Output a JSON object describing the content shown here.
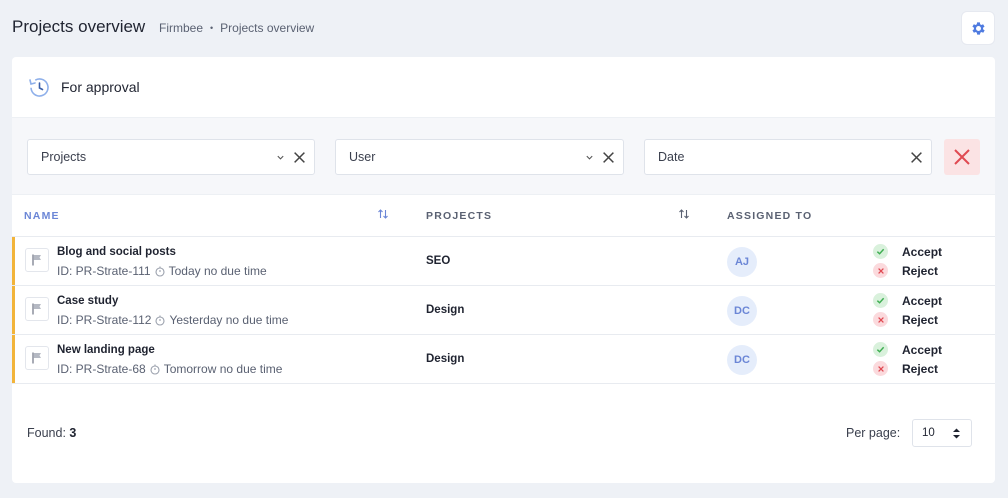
{
  "header": {
    "title": "Projects overview",
    "breadcrumb": [
      "Firmbee",
      "Projects overview"
    ],
    "breadcrumb_separator": "•"
  },
  "card": {
    "title": "For approval",
    "icon": "history-clock-icon"
  },
  "filters": [
    {
      "placeholder": "Projects",
      "has_dropdown": true
    },
    {
      "placeholder": "User",
      "has_dropdown": true
    },
    {
      "placeholder": "Date",
      "has_dropdown": false
    }
  ],
  "table": {
    "columns": [
      "NAME",
      "PROJECTS",
      "ASSIGNED TO"
    ],
    "rows": [
      {
        "name": "Blog and social posts",
        "id": "ID: PR-Strate-111",
        "due": "Today no due time",
        "project": "SEO",
        "assignee": "AJ",
        "accept_label": "Accept",
        "reject_label": "Reject"
      },
      {
        "name": "Case study",
        "id": "ID: PR-Strate-112",
        "due": "Yesterday no due time",
        "project": "Design",
        "assignee": "DC",
        "accept_label": "Accept",
        "reject_label": "Reject"
      },
      {
        "name": "New landing page",
        "id": "ID: PR-Strate-68",
        "due": "Tomorrow no due time",
        "project": "Design",
        "assignee": "DC",
        "accept_label": "Accept",
        "reject_label": "Reject"
      }
    ]
  },
  "footer": {
    "found_label": "Found:",
    "found_count": "3",
    "per_page_label": "Per page:",
    "per_page_value": "10"
  },
  "colors": {
    "accent": "#f2b43a",
    "primary": "#6b86d6",
    "success": "#3fae52",
    "danger": "#e04a52"
  }
}
